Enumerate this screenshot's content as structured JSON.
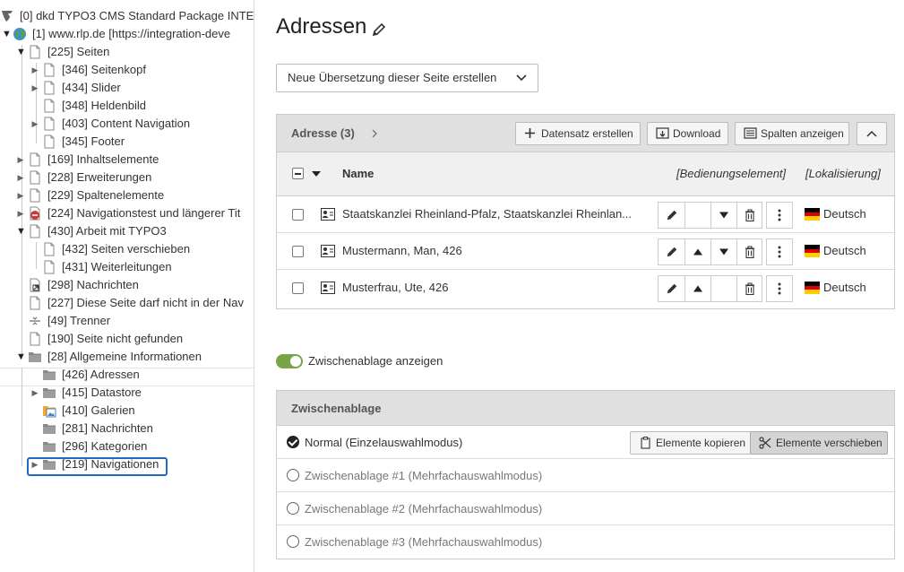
{
  "tree": {
    "nodes": [
      {
        "label": "[0] dkd TYPO3 CMS Standard Package INTE",
        "icon": "typo3-logo-icon"
      },
      {
        "label": "[1] www.rlp.de [https://integration-deve",
        "icon": "globe-icon"
      },
      {
        "label": "[225] Seiten",
        "icon": "page-icon"
      },
      {
        "label": "[346] Seitenkopf",
        "icon": "page-icon"
      },
      {
        "label": "[434] Slider",
        "icon": "page-icon"
      },
      {
        "label": "[348] Heldenbild",
        "icon": "page-icon"
      },
      {
        "label": "[403] Content Navigation",
        "icon": "page-icon"
      },
      {
        "label": "[345] Footer",
        "icon": "page-icon"
      },
      {
        "label": "[169] Inhaltselemente",
        "icon": "page-icon"
      },
      {
        "label": "[228] Erweiterungen",
        "icon": "page-icon"
      },
      {
        "label": "[229] Spaltenelemente",
        "icon": "page-icon"
      },
      {
        "label": "[224] Navigationstest und längerer Tit",
        "icon": "page-restricted-icon"
      },
      {
        "label": "[430] Arbeit mit TYPO3",
        "icon": "page-icon"
      },
      {
        "label": "[432] Seiten verschieben",
        "icon": "page-icon"
      },
      {
        "label": "[431] Weiterleitungen",
        "icon": "page-icon"
      },
      {
        "label": "[298] Nachrichten",
        "icon": "page-shortcut-icon"
      },
      {
        "label": "[227] Diese Seite darf nicht in der Nav",
        "icon": "page-icon"
      },
      {
        "label": "[49] Trenner",
        "icon": "spacer-icon"
      },
      {
        "label": "[190] Seite nicht gefunden",
        "icon": "page-icon"
      },
      {
        "label": "[28] Allgemeine Informationen",
        "icon": "folder-icon"
      },
      {
        "label": "[426] Adressen",
        "icon": "folder-icon"
      },
      {
        "label": "[415] Datastore",
        "icon": "folder-icon"
      },
      {
        "label": "[410] Galerien",
        "icon": "folder-image-icon"
      },
      {
        "label": "[281] Nachrichten",
        "icon": "folder-icon"
      },
      {
        "label": "[296] Kategorien",
        "icon": "folder-icon"
      },
      {
        "label": "[219] Navigationen",
        "icon": "folder-icon"
      }
    ]
  },
  "main": {
    "title": "Adressen",
    "translation_select": "Neue Übersetzung dieser Seite erstellen",
    "records": {
      "title": "Adresse (3)",
      "buttons": {
        "create": "Datensatz erstellen",
        "download": "Download",
        "columns": "Spalten anzeigen"
      },
      "columns": {
        "name": "Name",
        "controls": "[Bedienungselement]",
        "localization": "[Lokalisierung]"
      },
      "rows": [
        {
          "name": "Staatskanzlei Rheinland-Pfalz, Staatskanzlei Rheinlan...",
          "language": "Deutsch"
        },
        {
          "name": "Mustermann, Man, 426",
          "language": "Deutsch"
        },
        {
          "name": "Musterfrau, Ute, 426",
          "language": "Deutsch"
        }
      ]
    },
    "clipboard_toggle": "Zwischenablage anzeigen",
    "clipboard": {
      "title": "Zwischenablage",
      "copy_button": "Elemente kopieren",
      "move_button": "Elemente verschieben",
      "modes": [
        {
          "label": "Normal (Einzelauswahlmodus)",
          "checked": true
        },
        {
          "label": "Zwischenablage #1 (Mehrfachauswahlmodus)",
          "checked": false
        },
        {
          "label": "Zwischenablage #2 (Mehrfachauswahlmodus)",
          "checked": false
        },
        {
          "label": "Zwischenablage #3 (Mehrfachauswahlmodus)",
          "checked": false
        }
      ]
    }
  },
  "colors": {
    "toggle_on": "#79a548",
    "focus": "#2168c1",
    "flag_black": "#000000",
    "flag_red": "#dd0000",
    "flag_gold": "#ffce00"
  }
}
